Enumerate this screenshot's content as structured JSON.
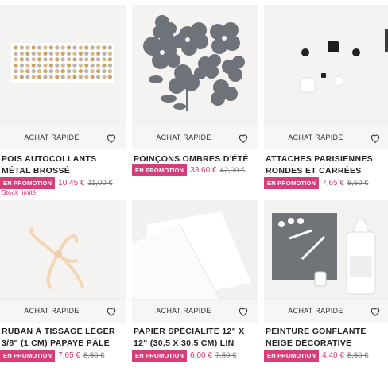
{
  "quick_label": "ACHAT RAPIDE",
  "products": [
    {
      "name": "POIS AUTOCOLLANTS MÉTAL BROSSÉ",
      "badge": "EN PROMOTION",
      "price": "10,45 €",
      "old_price": "11,00 €",
      "stock": "Stock limité"
    },
    {
      "name": "POINÇONS OMBRES D'ÉTÉ",
      "badge": "EN PROMOTION",
      "price": "33,60 €",
      "old_price": "42,00 €"
    },
    {
      "name": "ATTACHES PARISIENNES RONDES ET CARRÉES",
      "badge": "EN PROMOTION",
      "price": "7,65 €",
      "old_price": "8,50 €"
    },
    {
      "name": "RUBAN À TISSAGE LÉGER 3/8\" (1 CM) PAPAYE PÂLE",
      "badge": "EN PROMOTION",
      "price": "7,65 €",
      "old_price": "8,50 €"
    },
    {
      "name": "PAPIER SPÉCIALITÉ 12\" X 12\" (30,5 X 30,5 CM) LIN",
      "badge": "EN PROMOTION",
      "price": "6,00 €",
      "old_price": "7,50 €"
    },
    {
      "name": "PEINTURE GONFLANTE NEIGE DÉCORATIVE",
      "badge": "EN PROMOTION",
      "price": "4,40 €",
      "old_price": "5,50 €"
    }
  ],
  "colors": {
    "accent": "#d63d79",
    "tile_bg": "#f3f2f0"
  }
}
